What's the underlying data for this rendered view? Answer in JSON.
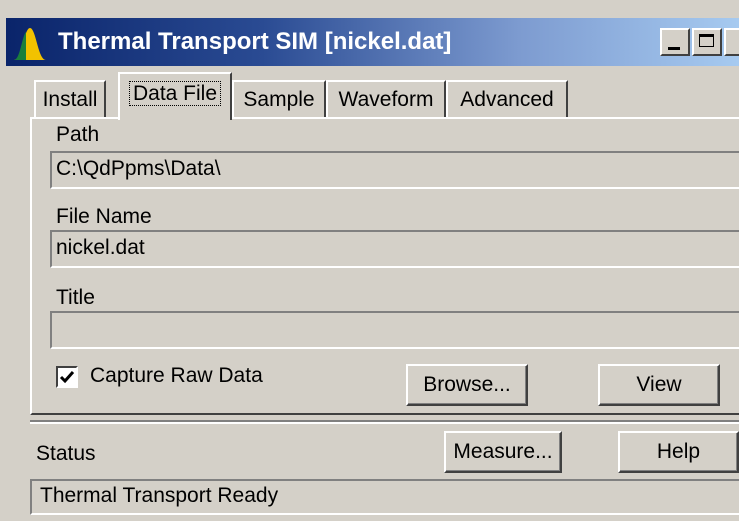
{
  "window": {
    "title": "Thermal Transport SIM [nickel.dat]",
    "app_icon": "thermal-peak-icon"
  },
  "tabs": [
    {
      "label": "Install",
      "active": false
    },
    {
      "label": "Data File",
      "active": true
    },
    {
      "label": "Sample",
      "active": false
    },
    {
      "label": "Waveform",
      "active": false
    },
    {
      "label": "Advanced",
      "active": false
    }
  ],
  "data_file": {
    "path_label": "Path",
    "path_value": "C:\\QdPpms\\Data\\",
    "filename_label": "File Name",
    "filename_value": "nickel.dat",
    "title_label": "Title",
    "title_value": "",
    "capture_raw_label": "Capture Raw Data",
    "capture_raw_checked": true,
    "browse_label": "Browse...",
    "view_label": "View"
  },
  "status": {
    "label": "Status",
    "text": "Thermal Transport Ready",
    "measure_label": "Measure...",
    "help_label": "Help"
  },
  "colors": {
    "face": "#d4d0c8",
    "title_start": "#0a246a",
    "title_end": "#a6caf0",
    "icon_fill": "#f2c200",
    "icon_accent": "#1a7f3c"
  }
}
